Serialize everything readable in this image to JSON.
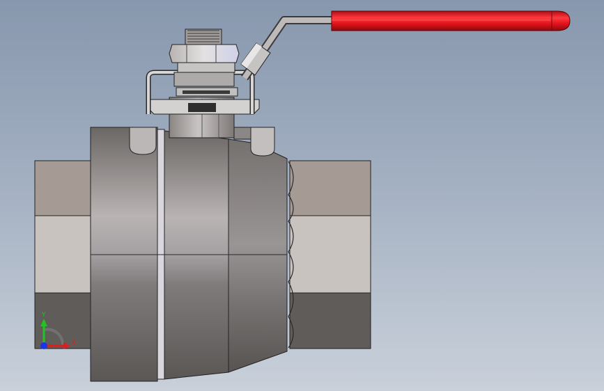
{
  "viewport": {
    "background_top": "#8797ad",
    "background_bottom": "#c9d0da",
    "model": "ball-valve-3d"
  },
  "model_colors": {
    "handle_grip": "#e0131b",
    "body_light": "#cfcbc9",
    "body_dark": "#595654",
    "end_face": "#a59a94"
  },
  "triad": {
    "x_label": "X",
    "y_label": "Y",
    "x_color": "#e11c1c",
    "y_color": "#22c322",
    "z_color": "#1a36e6"
  }
}
